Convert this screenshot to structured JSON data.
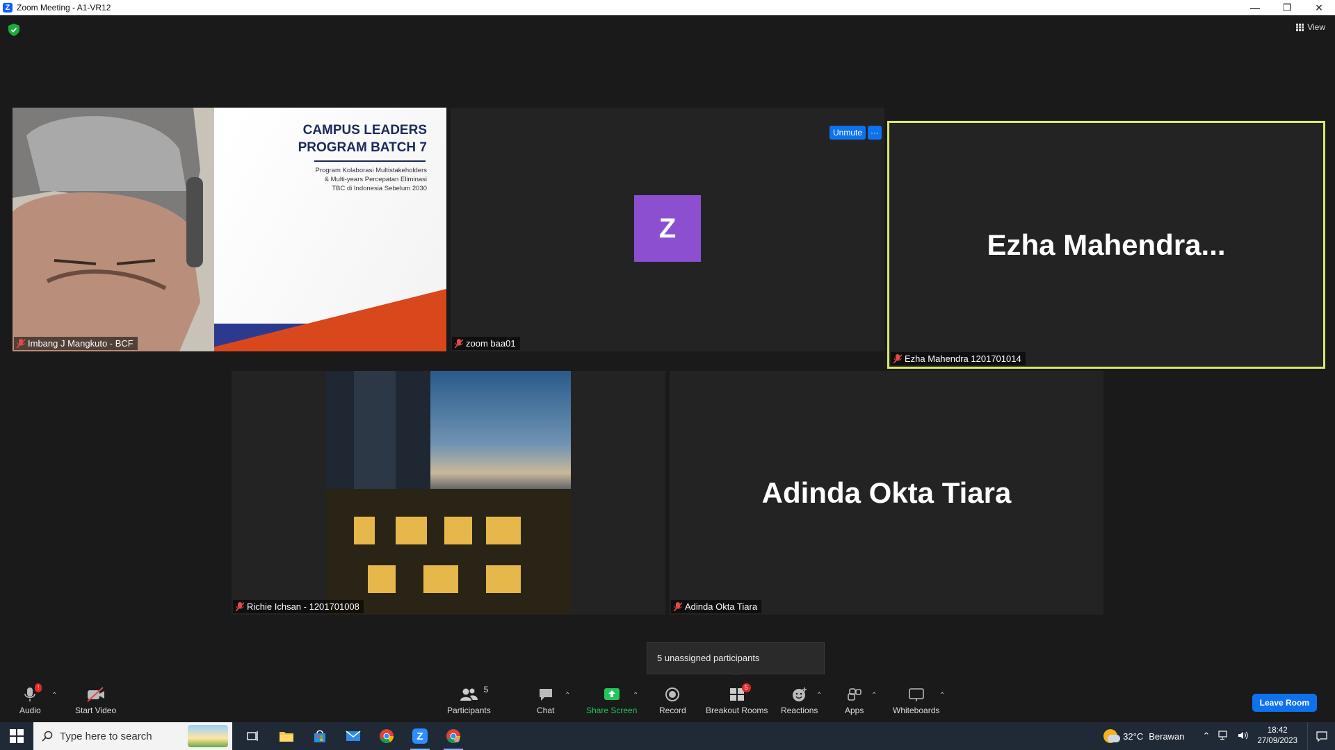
{
  "window": {
    "title": "Zoom Meeting - A1-VR12",
    "app_icon": "zoom-icon"
  },
  "top_bar": {
    "view_label": "View"
  },
  "tiles": [
    {
      "name": "Imbang J Mangkuto - BCF",
      "slide": {
        "title_line1": "CAMPUS LEADERS",
        "title_line2": "PROGRAM BATCH 7",
        "subtitle_line1": "Program Kolaborasi Multistakeholders",
        "subtitle_line2": "& Multi-years Percepatan Eliminasi",
        "subtitle_line3": "TBC di Indonesia Sebelum 2030"
      }
    },
    {
      "name": "zoom baa01",
      "avatar_letter": "Z",
      "avatar_color": "#8b4fd0"
    },
    {
      "name": "Ezha Mahendra 1201701014",
      "display_name": "Ezha  Mahendra...",
      "active_speaker_color": "#d9e96a"
    },
    {
      "name": "Richie Ichsan - 1201701008"
    },
    {
      "name": "Adinda Okta Tiara",
      "display_name": "Adinda Okta Tiara"
    }
  ],
  "hover_controls": {
    "unmute_label": "Unmute",
    "more_label": "···"
  },
  "tooltip": {
    "text": "5 unassigned participants"
  },
  "toolbar": {
    "audio": {
      "label": "Audio",
      "icon": "mic-muted-icon",
      "alert": "!"
    },
    "video": {
      "label": "Start Video",
      "icon": "video-off-icon"
    },
    "participants": {
      "label": "Participants",
      "count": "5",
      "icon": "participants-icon"
    },
    "chat": {
      "label": "Chat",
      "icon": "chat-icon"
    },
    "share": {
      "label": "Share Screen",
      "icon": "share-screen-icon",
      "color": "#22c55e"
    },
    "record": {
      "label": "Record",
      "icon": "record-icon"
    },
    "breakout": {
      "label": "Breakout Rooms",
      "badge": "5",
      "icon": "breakout-rooms-icon"
    },
    "reactions": {
      "label": "Reactions",
      "icon": "reactions-icon"
    },
    "apps": {
      "label": "Apps",
      "icon": "apps-icon"
    },
    "whiteboards": {
      "label": "Whiteboards",
      "icon": "whiteboard-icon"
    },
    "leave": {
      "label": "Leave Room",
      "color": "#0e72ed"
    }
  },
  "taskbar": {
    "search_placeholder": "Type here to search",
    "apps": [
      "task-view-icon",
      "file-explorer-icon",
      "store-icon",
      "mail-icon",
      "chrome-icon",
      "zoom-icon",
      "chrome-profile-icon"
    ],
    "weather": {
      "temp": "32°C",
      "condition": "Berawan"
    },
    "clock": {
      "time": "18:42",
      "date": "27/09/2023"
    }
  }
}
